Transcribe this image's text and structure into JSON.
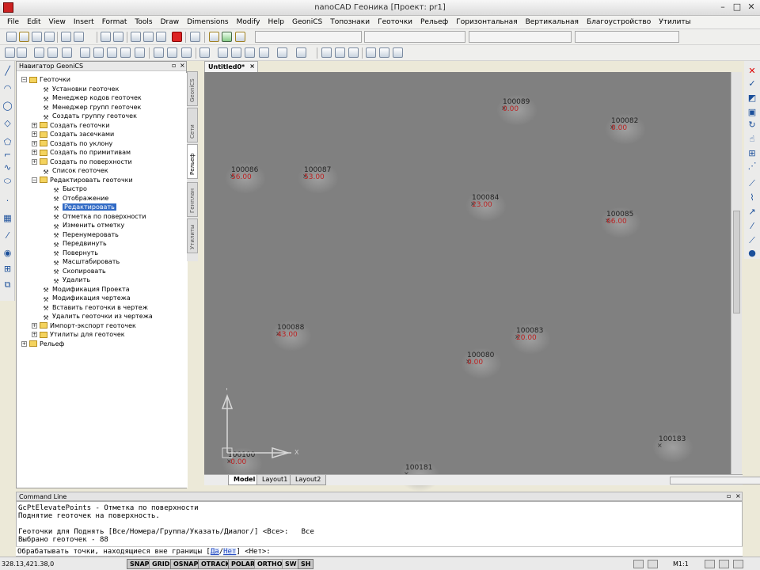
{
  "title": "nanoCAD Геоника [Проект: pr1]",
  "menu": [
    "File",
    "Edit",
    "View",
    "Insert",
    "Format",
    "Tools",
    "Draw",
    "Dimensions",
    "Modify",
    "Help",
    "GeoniCS",
    "Топознаки",
    "Геоточки",
    "Рельеф",
    "Горизонтальная",
    "Вертикальная",
    "Благоустройство",
    "Утилиты"
  ],
  "navigator": {
    "title": "Навигатор GeoniCS",
    "tree": [
      {
        "label": "Геоточки",
        "kind": "folder",
        "exp": "−",
        "indent": 0
      },
      {
        "label": "Установки геоточек",
        "kind": "tool",
        "indent": 2
      },
      {
        "label": "Менеджер кодов геоточек",
        "kind": "tool",
        "indent": 2
      },
      {
        "label": "Менеджер групп геоточек",
        "kind": "tool",
        "indent": 2
      },
      {
        "label": "Создать группу геоточек",
        "kind": "tool",
        "indent": 2
      },
      {
        "label": "Создать геоточки",
        "kind": "folder",
        "exp": "+",
        "indent": 1
      },
      {
        "label": "Создать засечками",
        "kind": "folder",
        "exp": "+",
        "indent": 1
      },
      {
        "label": "Создать по уклону",
        "kind": "folder",
        "exp": "+",
        "indent": 1
      },
      {
        "label": "Создать по примитивам",
        "kind": "folder",
        "exp": "+",
        "indent": 1
      },
      {
        "label": "Создать по поверхности",
        "kind": "folder",
        "exp": "+",
        "indent": 1
      },
      {
        "label": "Список геоточек",
        "kind": "tool",
        "indent": 2
      },
      {
        "label": "Редактировать геоточки",
        "kind": "folder",
        "exp": "−",
        "indent": 1
      },
      {
        "label": "Быстро",
        "kind": "tool",
        "indent": 3
      },
      {
        "label": "Отображение",
        "kind": "tool",
        "indent": 3
      },
      {
        "label": "Редактировать",
        "kind": "tool",
        "indent": 3,
        "selected": true
      },
      {
        "label": "Отметка по поверхности",
        "kind": "tool",
        "indent": 3
      },
      {
        "label": "Изменить отметку",
        "kind": "tool",
        "indent": 3
      },
      {
        "label": "Перенумеровать",
        "kind": "tool",
        "indent": 3
      },
      {
        "label": "Передвинуть",
        "kind": "tool",
        "indent": 3
      },
      {
        "label": "Повернуть",
        "kind": "tool",
        "indent": 3
      },
      {
        "label": "Масштабировать",
        "kind": "tool",
        "indent": 3
      },
      {
        "label": "Скопировать",
        "kind": "tool",
        "indent": 3
      },
      {
        "label": "Удалить",
        "kind": "tool",
        "indent": 3
      },
      {
        "label": "Модификация Проекта",
        "kind": "tool",
        "indent": 2
      },
      {
        "label": "Модификация чертежа",
        "kind": "tool",
        "indent": 2
      },
      {
        "label": "Вставить геоточки в чертеж",
        "kind": "tool",
        "indent": 2
      },
      {
        "label": "Удалить геоточки из чертежа",
        "kind": "tool",
        "indent": 2
      },
      {
        "label": "Импорт-экспорт геоточек",
        "kind": "folder",
        "exp": "+",
        "indent": 1
      },
      {
        "label": "Утилиты для геоточек",
        "kind": "folder",
        "exp": "+",
        "indent": 1
      },
      {
        "label": "Рельеф",
        "kind": "folder",
        "exp": "+",
        "indent": 0
      }
    ],
    "side_tabs": [
      "GeoniCS",
      "Сети",
      "Рельеф",
      "Генплан",
      "Утилиты"
    ]
  },
  "document": {
    "tab": "Untitled0*"
  },
  "layout_tabs": [
    "Model",
    "Layout1",
    "Layout2"
  ],
  "points": [
    {
      "num": "100089",
      "elev": "0.00"
    },
    {
      "num": "100082",
      "elev": "0.00"
    },
    {
      "num": "100086",
      "elev": "56.00"
    },
    {
      "num": "100087",
      "elev": "53.00"
    },
    {
      "num": "100084",
      "elev": "23.00"
    },
    {
      "num": "100085",
      "elev": "66.00"
    },
    {
      "num": "100088",
      "elev": "43.00"
    },
    {
      "num": "100083",
      "elev": "20.00"
    },
    {
      "num": "100080",
      "elev": "0.00"
    },
    {
      "num": "100100",
      "elev": "-0.00"
    },
    {
      "num": "100181",
      "elev": ""
    },
    {
      "num": "100183",
      "elev": ""
    }
  ],
  "ucs": {
    "x_label": "X",
    "y_label": "Y"
  },
  "command_line": {
    "title": "Command Line",
    "lines": [
      "GcPtElevatePoints - Отметка по поверхности",
      "Поднятие геоточек на поверхность.",
      "",
      "Геоточки для Поднять [Все/Номера/Группа/Указать/Диалог/] <Все>:   Все",
      "Выбрано геоточек - 88"
    ],
    "prompt_before": "Обрабатывать точки, находящиеся вне границы [",
    "prompt_opt1": "Да",
    "prompt_slash": "/",
    "prompt_opt2": "Нет",
    "prompt_after": "] <Нет>:"
  },
  "status": {
    "coords": "328.13,421.38,0",
    "buttons": [
      "SNAP",
      "GRID",
      "OSNAP",
      "OTRACK",
      "POLAR",
      "ORTHO",
      "SW",
      "SH"
    ],
    "scale": "M1:1"
  }
}
